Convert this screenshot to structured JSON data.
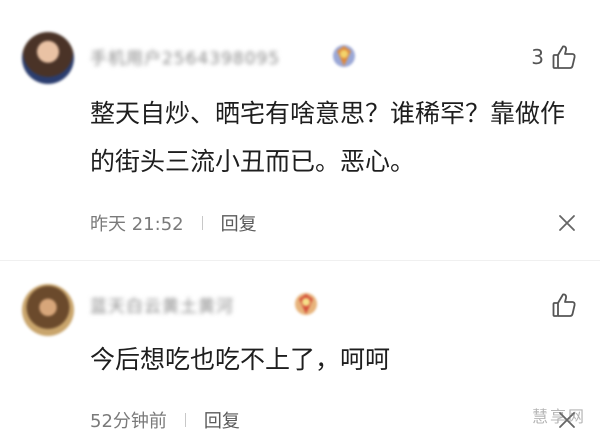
{
  "comments": [
    {
      "username": "手机用户2564398095",
      "likes": "3",
      "text": "整天自炒、晒宅有啥意思？谁稀罕？靠做作的街头三流小丑而已。恶心。",
      "time": "昨天 21:52",
      "reply_label": "回复",
      "icons": [
        "avatar",
        "badge-icon",
        "thumb-up-icon",
        "more-icon"
      ]
    },
    {
      "username": "蓝天白云黄土黄河",
      "likes": "",
      "text": "今后想吃也吃不上了，呵呵",
      "time": "52分钟前",
      "reply_label": "回复",
      "icons": [
        "avatar",
        "badge-icon",
        "thumb-up-icon",
        "more-icon"
      ]
    }
  ],
  "watermark": "慧享网"
}
